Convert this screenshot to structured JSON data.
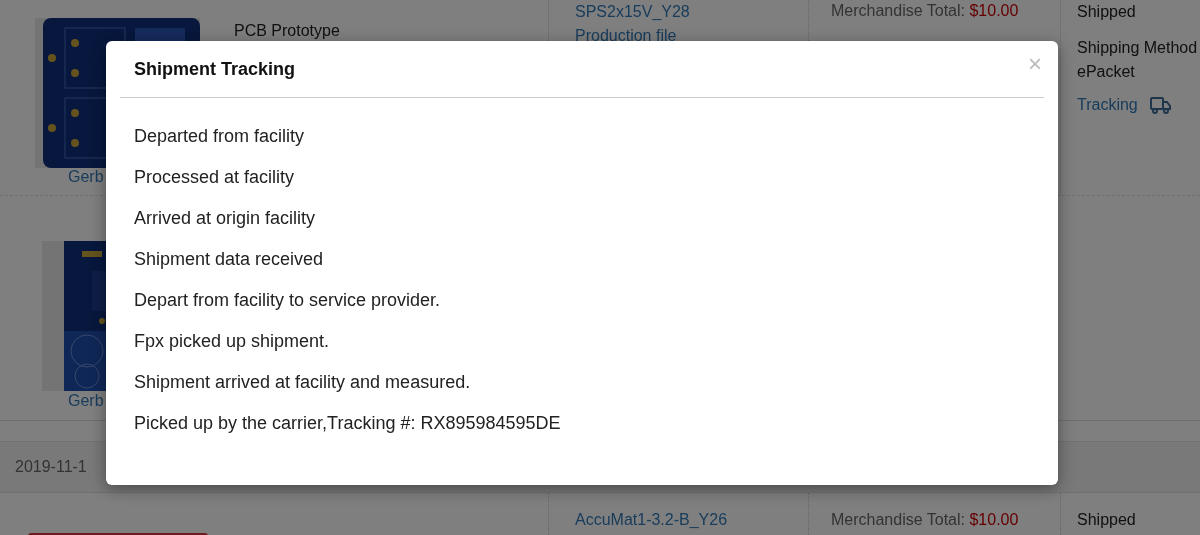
{
  "orders": [
    {
      "image_caption": "Gerb",
      "product": "PCB Prototype",
      "file_name": "SPS2x15V_Y28",
      "file_link": "Production file",
      "total_label": "Merchandise Total:",
      "total": "$10.00",
      "status": "Shipped",
      "shipping_method_label": "Shipping Method",
      "shipping_method": "ePacket",
      "tracking_link": "Tracking"
    },
    {
      "image_caption": "Gerb"
    }
  ],
  "date_bar": "2019-11-1",
  "next_order": {
    "file_name": "AccuMat1-3.2-B_Y26",
    "total_label": "Merchandise Total:",
    "total": "$10.00",
    "status": "Shipped"
  },
  "modal": {
    "title": "Shipment Tracking",
    "close": "×",
    "events": [
      "Departed from facility",
      "Processed at facility",
      "Arrived at origin facility",
      "Shipment data received",
      "Depart from facility to service provider.",
      "Fpx picked up shipment.",
      "Shipment arrived at facility and measured.",
      "Picked up by the carrier,Tracking #: RX895984595DE"
    ]
  }
}
